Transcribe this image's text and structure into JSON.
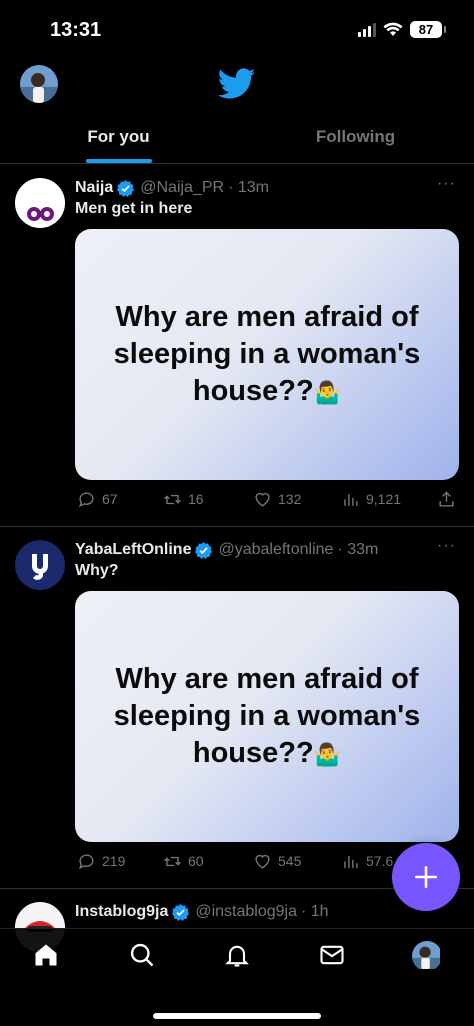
{
  "status_bar": {
    "time": "13:31",
    "battery": "87"
  },
  "tabs": [
    {
      "label": "For you",
      "active": true
    },
    {
      "label": "Following",
      "active": false
    }
  ],
  "tweets": [
    {
      "name": "Naija",
      "handle": "@Naija_PR",
      "time": "· 13m",
      "text": "Men get in here",
      "media_text": "Why are men afraid of sleeping in a woman's house??",
      "media_emoji": "🤷‍♂️",
      "replies": "67",
      "retweets": "16",
      "likes": "132",
      "views": "9,121"
    },
    {
      "name": "YabaLeftOnline",
      "handle": "@yabaleftonline",
      "time": "· 33m",
      "text": "Why?",
      "media_text": "Why are men afraid of sleeping in a woman's house??",
      "media_emoji": "🤷‍♂️",
      "replies": "219",
      "retweets": "60",
      "likes": "545",
      "views": "57.6"
    },
    {
      "name": "Instablog9ja",
      "handle": "@instablog9ja",
      "time": "· 1h"
    }
  ],
  "icons": {
    "more": "···",
    "bird": "twitter-bird-icon",
    "verified": "verified-badge-icon",
    "compose": "plus-icon"
  },
  "colors": {
    "accent": "#1d9bf0",
    "fab": "#7856ff",
    "background": "#000000",
    "muted": "#71767b"
  }
}
